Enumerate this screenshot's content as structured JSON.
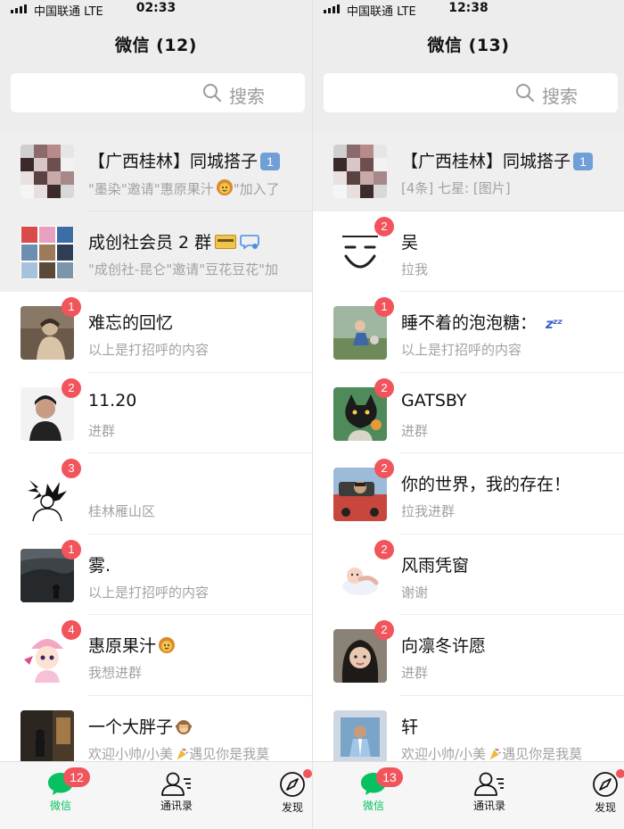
{
  "panels": [
    {
      "status": {
        "carrier": "中国联通  LTE",
        "time": "02:33"
      },
      "title": "微信 (12)",
      "search": {
        "placeholder": "搜索"
      },
      "chats": [
        {
          "name": "【广西桂林】同城搭子",
          "tag": "1",
          "msg": "\"墨染\"邀请\"惠原果汁",
          "msg_tail": "\"加入了",
          "pinned": true,
          "avatar": "mosaic",
          "badge": ""
        },
        {
          "name": "成创社会员 2 群",
          "msg": "\"成创社-昆仑\"邀请\"豆花豆花\"加",
          "pinned": true,
          "avatar": "grid",
          "badge": "",
          "extras": "card"
        },
        {
          "name": "难忘的回忆",
          "msg": "以上是打招呼的内容",
          "pinned": false,
          "avatar": "sepia",
          "badge": "1"
        },
        {
          "name": "11.20",
          "msg": "进群",
          "pinned": false,
          "avatar": "portrait",
          "badge": "2"
        },
        {
          "name": "",
          "msg": "桂林雁山区",
          "pinned": false,
          "avatar": "sketch",
          "badge": "3"
        },
        {
          "name": "雾.",
          "msg": "以上是打招呼的内容",
          "pinned": false,
          "avatar": "dark",
          "badge": "1"
        },
        {
          "name": "惠原果汁",
          "msg": "我想进群",
          "pinned": false,
          "avatar": "anime",
          "badge": "4",
          "extras": "lion"
        },
        {
          "name": "一个大胖子",
          "msg": "欢迎小帅/小美",
          "msg_tail": "遇见你是我莫",
          "pinned": false,
          "avatar": "night",
          "badge": "",
          "extras": "monkey"
        }
      ],
      "tabbar": {
        "chats": "微信",
        "contacts": "通讯录",
        "discover": "发现",
        "chats_badge": "12"
      }
    },
    {
      "status": {
        "carrier": "中国联通  LTE",
        "time": "12:38"
      },
      "title": "微信 (13)",
      "search": {
        "placeholder": "搜索"
      },
      "chats": [
        {
          "name": "【广西桂林】同城搭子",
          "tag": "1",
          "msg": "[4条] 七星: [图片]",
          "pinned": true,
          "avatar": "mosaic",
          "badge": ""
        },
        {
          "name": "吴",
          "msg": "拉我",
          "pinned": false,
          "avatar": "smile",
          "badge": "2"
        },
        {
          "name": "睡不着的泡泡糖：",
          "msg": "以上是打招呼的内容",
          "pinned": false,
          "avatar": "child",
          "badge": "1",
          "extras": "zzz"
        },
        {
          "name": "GATSBY",
          "msg": "进群",
          "pinned": false,
          "avatar": "cat",
          "badge": "2"
        },
        {
          "name": "你的世界，我的存在！",
          "msg": "拉我进群",
          "pinned": false,
          "avatar": "car",
          "badge": "2"
        },
        {
          "name": "风雨凭窗",
          "msg": "谢谢",
          "pinned": false,
          "avatar": "baby",
          "badge": "2"
        },
        {
          "name": "向凛冬许愿",
          "msg": "进群",
          "pinned": false,
          "avatar": "girl",
          "badge": "2"
        },
        {
          "name": "轩",
          "msg": "欢迎小帅/小美",
          "msg_tail": "遇见你是我莫",
          "pinned": false,
          "avatar": "sport",
          "badge": ""
        }
      ],
      "tabbar": {
        "chats": "微信",
        "contacts": "通讯录",
        "discover": "发现",
        "chats_badge": "13"
      }
    }
  ],
  "colors": {
    "accent_green": "#07c160",
    "badge_red": "#f2545b",
    "muted_text": "#a2a2a2"
  }
}
